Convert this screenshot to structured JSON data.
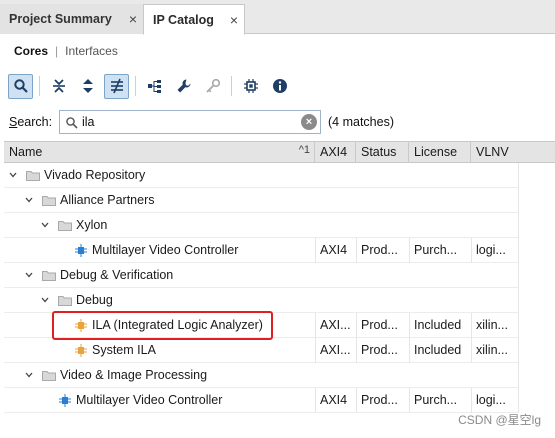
{
  "tabs": [
    {
      "label": "Project Summary",
      "close": "×"
    },
    {
      "label": "IP Catalog",
      "close": "×"
    }
  ],
  "subtabs": {
    "current": "Cores",
    "separator": "|",
    "other": "Interfaces"
  },
  "toolbar": {
    "icons": [
      "search-icon",
      "collapse-all-icon",
      "expand-all-icon",
      "filter-icon",
      "hierarchy-icon",
      "wrench-icon",
      "key-icon",
      "chip-icon",
      "info-icon"
    ]
  },
  "search": {
    "label_prefix": "S",
    "label_rest": "earch:",
    "value": "ila",
    "clear": "×",
    "matches": "(4 matches)"
  },
  "columns": [
    {
      "label": "Name",
      "sort": "^1"
    },
    {
      "label": "AXI4"
    },
    {
      "label": "Status"
    },
    {
      "label": "License"
    },
    {
      "label": "VLNV"
    }
  ],
  "rows": [
    {
      "name": "Vivado Repository",
      "kind": "folder",
      "level": 0
    },
    {
      "name": "Alliance Partners",
      "kind": "folder",
      "level": 1
    },
    {
      "name": "Xylon",
      "kind": "folder",
      "level": 2
    },
    {
      "name": "Multilayer Video Controller",
      "kind": "ip",
      "level": 3,
      "axi4": "AXI4",
      "status": "Prod...",
      "license": "Purch...",
      "vlnv": "logi..."
    },
    {
      "name": "Debug & Verification",
      "kind": "folder",
      "level": 1
    },
    {
      "name": "Debug",
      "kind": "folder",
      "level": 2
    },
    {
      "name": "ILA (Integrated Logic Analyzer)",
      "kind": "ip",
      "level": 3,
      "axi4": "AXI...",
      "status": "Prod...",
      "license": "Included",
      "vlnv": "xilin..."
    },
    {
      "name": "System ILA",
      "kind": "ip",
      "level": 3,
      "axi4": "AXI...",
      "status": "Prod...",
      "license": "Included",
      "vlnv": "xilin..."
    },
    {
      "name": "Video & Image Processing",
      "kind": "folder",
      "level": 1
    },
    {
      "name": "Multilayer Video Controller",
      "kind": "ip",
      "level": 2,
      "axi4": "AXI4",
      "status": "Prod...",
      "license": "Purch...",
      "vlnv": "logi..."
    }
  ],
  "watermark": "CSDN @星空lg",
  "colors": {
    "highlight": "#e02020",
    "active_tool": "#cfe2f3",
    "ip_blue": "#2a7fd4",
    "ip_orange": "#e8a33a",
    "folder": "#d8d8d8"
  }
}
